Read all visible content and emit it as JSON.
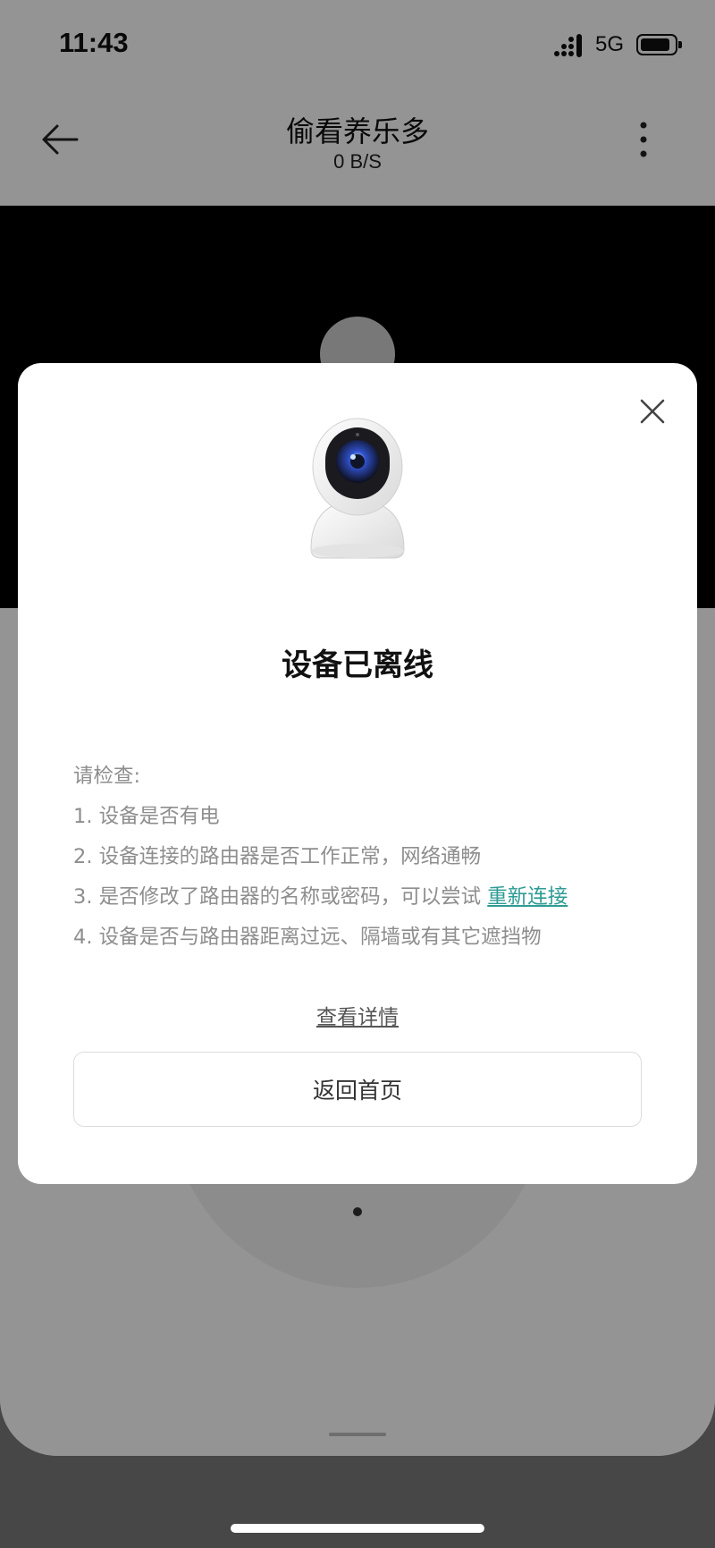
{
  "status_bar": {
    "time": "11:43",
    "network": "5G",
    "icons": [
      "signal-icon",
      "battery-icon"
    ]
  },
  "header": {
    "title": "偷看养乐多",
    "subtitle": "0 B/S",
    "icons": [
      "back-arrow-icon",
      "more-vertical-icon"
    ]
  },
  "modal": {
    "title": "设备已离线",
    "checklist_heading": "请检查:",
    "items": [
      "1. 设备是否有电",
      "2. 设备连接的路由器是否工作正常，网络通畅",
      "3. 是否修改了路由器的名称或密码，可以尝试",
      "4. 设备是否与路由器距离过远、隔墙或有其它遮挡物"
    ],
    "reconnect_link": "重新连接",
    "details_link": "查看详情",
    "home_button": "返回首页",
    "icons": [
      "close-icon",
      "security-camera-icon"
    ]
  },
  "colors": {
    "link": "#2e9b94",
    "overlay": "rgba(0,0,0,0.42)",
    "background": "#474747"
  }
}
